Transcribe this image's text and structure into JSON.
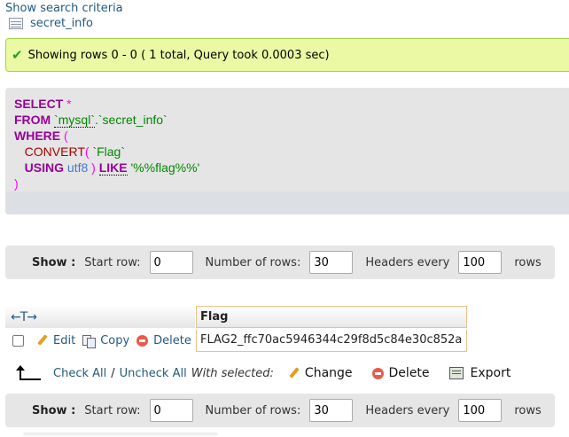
{
  "top": {
    "show_search_criteria": "Show search criteria",
    "table_name": "secret_info"
  },
  "success": {
    "message": "Showing rows 0 - 0 ( 1 total, Query took 0.0003 sec)"
  },
  "sql": {
    "select": "SELECT",
    "star": "*",
    "from": "FROM",
    "db": "`mysql`",
    "dot": ".",
    "table": "`secret_info`",
    "where": "WHERE",
    "open_paren": "(",
    "convert": "CONVERT",
    "convert_paren": "(",
    "column": "`Flag`",
    "using": "USING",
    "charset": "utf8",
    "close_inner": ")",
    "like": "LIKE",
    "pattern": "'%%flag%%'",
    "close_paren": ")"
  },
  "nav": {
    "show_label": "Show :",
    "start_row_label": "Start row:",
    "start_row_value": "0",
    "num_rows_label": "Number of rows:",
    "num_rows_value": "30",
    "headers_every_label": "Headers every",
    "headers_every_value": "100",
    "rows_suffix": "rows"
  },
  "table": {
    "sort_arrows": "←T→",
    "columns": [
      "Flag"
    ],
    "rows": [
      {
        "flag": "FLAG2_ffc70ac5946344c29f8d5c84e30c852a"
      }
    ],
    "row_actions": {
      "edit": "Edit",
      "copy": "Copy",
      "delete": "Delete"
    }
  },
  "bulk": {
    "check_all": "Check All",
    "separator": "/",
    "uncheck_all": "Uncheck All",
    "with_selected": "With selected:",
    "change": "Change",
    "delete": "Delete",
    "export": "Export"
  }
}
